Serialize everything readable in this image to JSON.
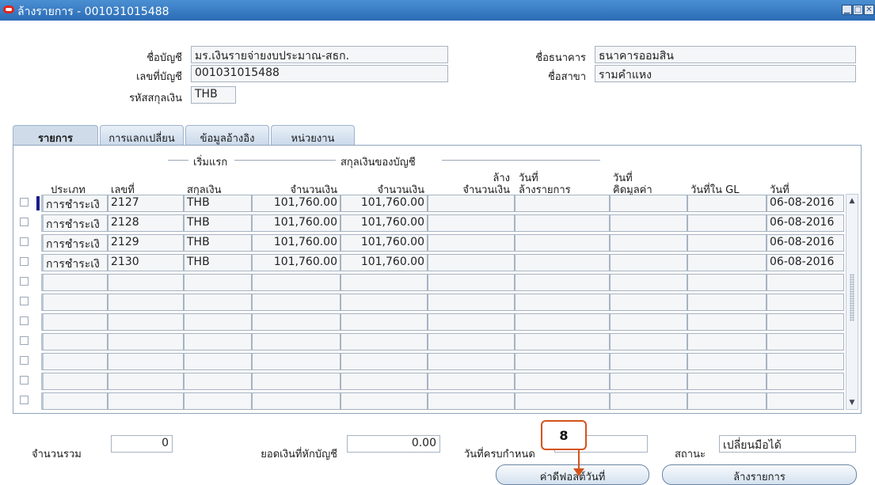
{
  "window": {
    "title": "ล้างรายการ - 001031015488"
  },
  "header": {
    "account_name_label": "ชื่อบัญชี",
    "account_name": "มร.เงินรายจ่ายงบประมาณ-สธก.",
    "account_no_label": "เลขที่บัญชี",
    "account_no": "001031015488",
    "currency_label": "รหัสสกุลเงิน",
    "currency": "THB",
    "bank_name_label": "ชื่อธนาคาร",
    "bank_name": "ธนาคารออมสิน",
    "branch_label": "ชื่อสาขา",
    "branch": "รามคำแหง"
  },
  "tabs": [
    "รายการ",
    "การแลกเปลี่ยน",
    "ข้อมูลอ้างอิง",
    "หน่วยงาน"
  ],
  "columns": {
    "group_initial": "เริ่มแรก",
    "group_account_currency": "สกุลเงินของบัญชี",
    "type": "ประเภท",
    "number": "เลขที่",
    "currency": "สกุลเงิน",
    "amount1": "จำนวนเงิน",
    "amount2": "จำนวนเงิน",
    "cleared_top": "ล้าง",
    "cleared_amount": "จำนวนเงิน",
    "cleared_date_top": "วันที่",
    "cleared_date": "ล้างรายการ",
    "value_date_top": "วันที่",
    "value_date": "คิดมูลค่า",
    "gl_date": "วันที่ใน GL",
    "date": "วันที่"
  },
  "rows": [
    {
      "type": "การชำระเงิ",
      "number": "2127",
      "currency": "THB",
      "amount1": "101,760.00",
      "amount2": "101,760.00",
      "cleared_amount": "",
      "cleared_date": "",
      "value_date": "",
      "gl_date": "",
      "date": "06-08-2016"
    },
    {
      "type": "การชำระเงิ",
      "number": "2128",
      "currency": "THB",
      "amount1": "101,760.00",
      "amount2": "101,760.00",
      "cleared_amount": "",
      "cleared_date": "",
      "value_date": "",
      "gl_date": "",
      "date": "06-08-2016"
    },
    {
      "type": "การชำระเงิ",
      "number": "2129",
      "currency": "THB",
      "amount1": "101,760.00",
      "amount2": "101,760.00",
      "cleared_amount": "",
      "cleared_date": "",
      "value_date": "",
      "gl_date": "",
      "date": "06-08-2016"
    },
    {
      "type": "การชำระเงิ",
      "number": "2130",
      "currency": "THB",
      "amount1": "101,760.00",
      "amount2": "101,760.00",
      "cleared_amount": "",
      "cleared_date": "",
      "value_date": "",
      "gl_date": "",
      "date": "06-08-2016"
    },
    {
      "type": "",
      "number": "",
      "currency": "",
      "amount1": "",
      "amount2": "",
      "cleared_amount": "",
      "cleared_date": "",
      "value_date": "",
      "gl_date": "",
      "date": ""
    },
    {
      "type": "",
      "number": "",
      "currency": "",
      "amount1": "",
      "amount2": "",
      "cleared_amount": "",
      "cleared_date": "",
      "value_date": "",
      "gl_date": "",
      "date": ""
    },
    {
      "type": "",
      "number": "",
      "currency": "",
      "amount1": "",
      "amount2": "",
      "cleared_amount": "",
      "cleared_date": "",
      "value_date": "",
      "gl_date": "",
      "date": ""
    },
    {
      "type": "",
      "number": "",
      "currency": "",
      "amount1": "",
      "amount2": "",
      "cleared_amount": "",
      "cleared_date": "",
      "value_date": "",
      "gl_date": "",
      "date": ""
    },
    {
      "type": "",
      "number": "",
      "currency": "",
      "amount1": "",
      "amount2": "",
      "cleared_amount": "",
      "cleared_date": "",
      "value_date": "",
      "gl_date": "",
      "date": ""
    },
    {
      "type": "",
      "number": "",
      "currency": "",
      "amount1": "",
      "amount2": "",
      "cleared_amount": "",
      "cleared_date": "",
      "value_date": "",
      "gl_date": "",
      "date": ""
    },
    {
      "type": "",
      "number": "",
      "currency": "",
      "amount1": "",
      "amount2": "",
      "cleared_amount": "",
      "cleared_date": "",
      "value_date": "",
      "gl_date": "",
      "date": ""
    }
  ],
  "footer": {
    "count_label": "จำนวนรวม",
    "count": "0",
    "balance_label": "ยอดเงินที่หักบัญชี",
    "balance": "0.00",
    "due_date_label": "วันที่ครบกำหนด",
    "due_date": "",
    "status_label": "สถานะ",
    "status": "เปลี่ยนมือได้"
  },
  "buttons": {
    "default_date": "ค่าดีฟอลต์วันที่",
    "clear": "ล้างรายการ"
  },
  "callout": {
    "number": "8"
  },
  "colors": {
    "titlebar": "#2b6cb5",
    "callout": "#d4531b"
  }
}
